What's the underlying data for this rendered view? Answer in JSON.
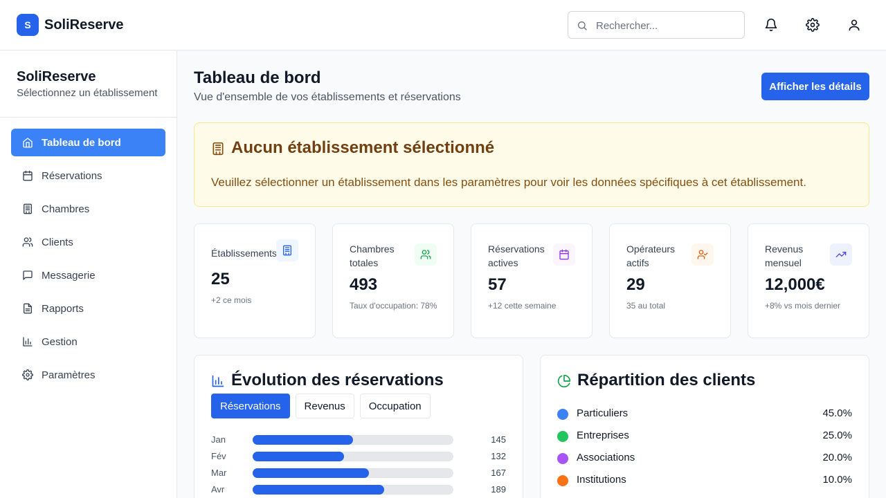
{
  "header": {
    "logo_letter": "S",
    "app_title": "SoliReserve",
    "search_placeholder": "Rechercher...",
    "icons": [
      "bell-icon",
      "gear-icon",
      "user-icon"
    ]
  },
  "sidebar": {
    "title": "SoliReserve",
    "subtitle": "Sélectionnez un établissement",
    "items": [
      {
        "label": "Tableau de bord",
        "icon": "home-icon",
        "active": true
      },
      {
        "label": "Réservations",
        "icon": "calendar-icon",
        "active": false
      },
      {
        "label": "Chambres",
        "icon": "building-icon",
        "active": false
      },
      {
        "label": "Clients",
        "icon": "users-icon",
        "active": false
      },
      {
        "label": "Messagerie",
        "icon": "message-icon",
        "active": false
      },
      {
        "label": "Rapports",
        "icon": "file-icon",
        "active": false
      },
      {
        "label": "Gestion",
        "icon": "bar-chart-icon",
        "active": false
      },
      {
        "label": "Paramètres",
        "icon": "gear-icon",
        "active": false
      }
    ]
  },
  "main": {
    "title": "Tableau de bord",
    "subtitle": "Vue d'ensemble de vos établissements et réservations",
    "details_button": "Afficher les détails"
  },
  "alert": {
    "title": "Aucun établissement sélectionné",
    "text": "Veuillez sélectionner un établissement dans les paramètres pour voir les données spécifiques à cet établissement."
  },
  "stats": [
    {
      "label": "Établissements",
      "value": "25",
      "note": "+2 ce mois",
      "icon": "building-icon",
      "color": "#2563eb"
    },
    {
      "label": "Chambres totales",
      "value": "493",
      "note": "Taux d'occupation: 78%",
      "icon": "users-icon",
      "color": "#16a34a"
    },
    {
      "label": "Réservations actives",
      "value": "57",
      "note": "+12 cette semaine",
      "icon": "calendar-icon",
      "color": "#9333ea"
    },
    {
      "label": "Opérateurs actifs",
      "value": "29",
      "note": "35 au total",
      "icon": "user-check-icon",
      "color": "#ea580c"
    },
    {
      "label": "Revenus mensuel",
      "value": "12,000€",
      "note": "+8% vs mois dernier",
      "icon": "trending-up-icon",
      "color": "#4f46e5"
    }
  ],
  "evolution": {
    "title": "Évolution des réservations",
    "tabs": [
      "Réservations",
      "Revenus",
      "Occupation"
    ],
    "active_tab": 0,
    "rows": [
      {
        "label": "Jan",
        "value": "145",
        "fraction": 0.5
      },
      {
        "label": "Fév",
        "value": "132",
        "fraction": 0.455
      },
      {
        "label": "Mar",
        "value": "167",
        "fraction": 0.579
      },
      {
        "label": "Avr",
        "value": "189",
        "fraction": 0.655
      }
    ]
  },
  "repartition": {
    "title": "Répartition des clients",
    "items": [
      {
        "name": "Particuliers",
        "pct": "45.0%",
        "color": "#3b82f6"
      },
      {
        "name": "Entreprises",
        "pct": "25.0%",
        "color": "#22c55e"
      },
      {
        "name": "Associations",
        "pct": "20.0%",
        "color": "#a855f7"
      },
      {
        "name": "Institutions",
        "pct": "10.0%",
        "color": "#f97316"
      }
    ]
  }
}
